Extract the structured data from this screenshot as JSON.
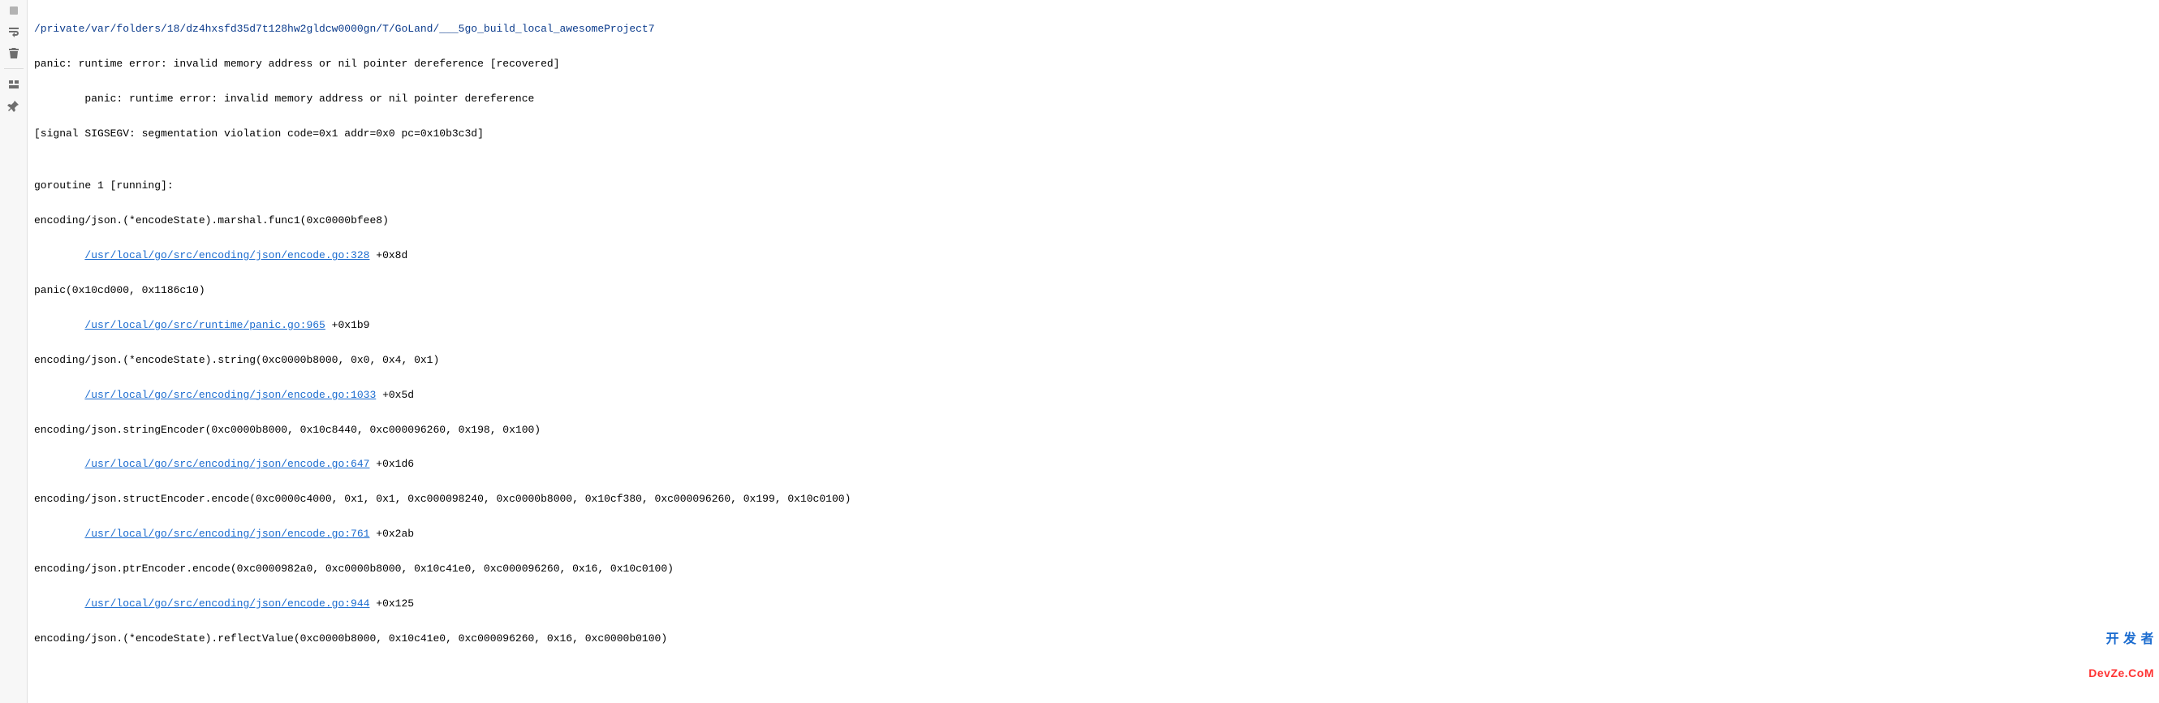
{
  "gutter": {
    "icons": [
      {
        "name": "stop-icon"
      },
      {
        "name": "wrap-text-icon"
      },
      {
        "name": "trash-icon"
      }
    ],
    "icons2": [
      {
        "name": "layout-icon"
      },
      {
        "name": "pin-icon"
      }
    ]
  },
  "console": {
    "command_line": "/private/var/folders/18/dz4hxsfd35d7t128hw2gldcw0000gn/T/GoLand/___5go_build_local_awesomeProject7",
    "plain_lines_1": [
      "panic: runtime error: invalid memory address or nil pointer dereference [recovered]",
      "        panic: runtime error: invalid memory address or nil pointer dereference",
      "[signal SIGSEGV: segmentation violation code=0x1 addr=0x0 pc=0x10b3c3d]",
      "",
      "goroutine 1 [running]:",
      "encoding/json.(*encodeState).marshal.func1(0xc0000bfee8)"
    ],
    "stack": [
      {
        "link": "/usr/local/go/src/encoding/json/encode.go:328",
        "trailing": " +0x8d",
        "after_plain": "panic(0x10cd000, 0x1186c10)"
      },
      {
        "link": "/usr/local/go/src/runtime/panic.go:965",
        "trailing": " +0x1b9",
        "after_plain": "encoding/json.(*encodeState).string(0xc0000b8000, 0x0, 0x4, 0x1)"
      },
      {
        "link": "/usr/local/go/src/encoding/json/encode.go:1033",
        "trailing": " +0x5d",
        "after_plain": "encoding/json.stringEncoder(0xc0000b8000, 0x10c8440, 0xc000096260, 0x198, 0x100)"
      },
      {
        "link": "/usr/local/go/src/encoding/json/encode.go:647",
        "trailing": " +0x1d6",
        "after_plain": "encoding/json.structEncoder.encode(0xc0000c4000, 0x1, 0x1, 0xc000098240, 0xc0000b8000, 0x10cf380, 0xc000096260, 0x199, 0x10c0100)"
      },
      {
        "link": "/usr/local/go/src/encoding/json/encode.go:761",
        "trailing": " +0x2ab",
        "after_plain": "encoding/json.ptrEncoder.encode(0xc0000982a0, 0xc0000b8000, 0x10c41e0, 0xc000096260, 0x16, 0x10c0100)"
      },
      {
        "link": "/usr/local/go/src/encoding/json/encode.go:944",
        "trailing": " +0x125",
        "after_plain": "encoding/json.(*encodeState).reflectValue(0xc0000b8000, 0x10c41e0, 0xc000096260, 0x16, 0xc0000b0100)"
      }
    ]
  },
  "watermark": {
    "line1": "开 发 者",
    "line2": "DevZe.CoM"
  }
}
